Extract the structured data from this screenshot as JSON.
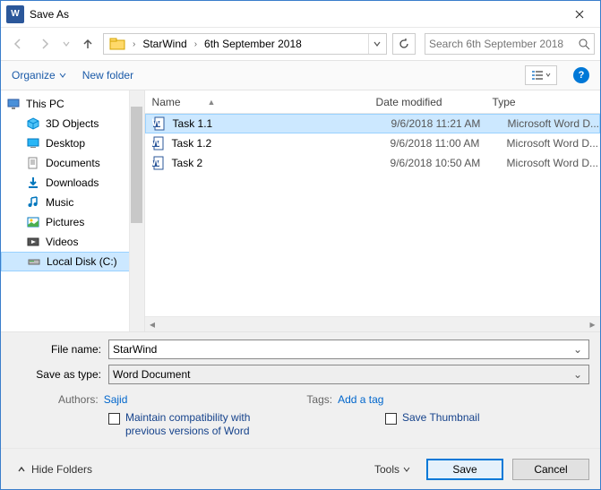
{
  "window": {
    "title": "Save As"
  },
  "nav": {
    "crumbs": [
      "StarWind",
      "6th September 2018"
    ],
    "search_placeholder": "Search 6th September 2018"
  },
  "toolbar": {
    "organize": "Organize",
    "newfolder": "New folder"
  },
  "sidebar": {
    "items": [
      {
        "label": "This PC",
        "icon": "pc"
      },
      {
        "label": "3D Objects",
        "icon": "3d"
      },
      {
        "label": "Desktop",
        "icon": "desktop"
      },
      {
        "label": "Documents",
        "icon": "docs"
      },
      {
        "label": "Downloads",
        "icon": "downloads"
      },
      {
        "label": "Music",
        "icon": "music"
      },
      {
        "label": "Pictures",
        "icon": "pictures"
      },
      {
        "label": "Videos",
        "icon": "videos"
      },
      {
        "label": "Local Disk (C:)",
        "icon": "disk"
      }
    ]
  },
  "cols": {
    "name": "Name",
    "date": "Date modified",
    "type": "Type"
  },
  "files": [
    {
      "name": "Task 1.1",
      "date": "9/6/2018 11:21 AM",
      "type": "Microsoft Word D...",
      "selected": true
    },
    {
      "name": "Task 1.2",
      "date": "9/6/2018 11:00 AM",
      "type": "Microsoft Word D...",
      "selected": false
    },
    {
      "name": "Task 2",
      "date": "9/6/2018 10:50 AM",
      "type": "Microsoft Word D...",
      "selected": false
    }
  ],
  "fields": {
    "filename_label": "File name:",
    "filename_value": "StarWind",
    "type_label": "Save as type:",
    "type_value": "Word Document"
  },
  "meta": {
    "authors_label": "Authors:",
    "authors_value": "Sajid",
    "tags_label": "Tags:",
    "tags_value": "Add a tag"
  },
  "checks": {
    "compat": "Maintain compatibility with previous versions of Word",
    "thumb": "Save Thumbnail"
  },
  "footer": {
    "hide": "Hide Folders",
    "tools": "Tools",
    "save": "Save",
    "cancel": "Cancel"
  }
}
